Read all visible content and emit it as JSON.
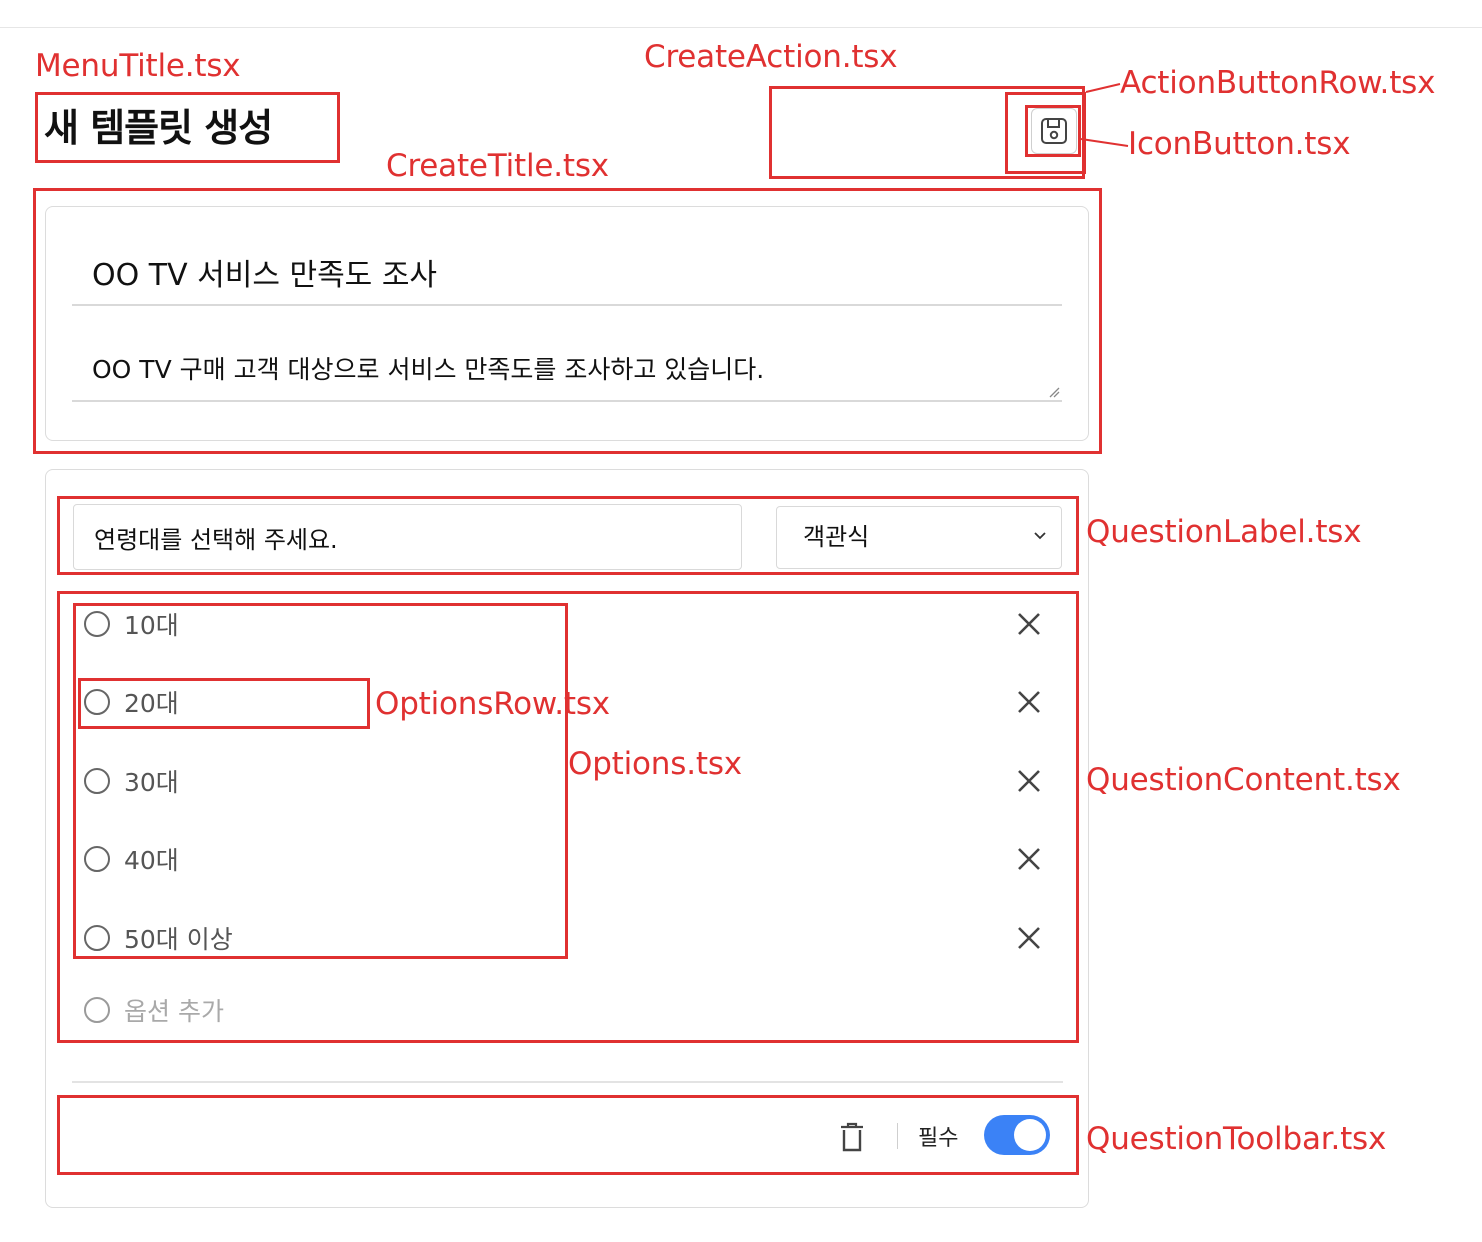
{
  "header": {
    "page_title": "새 템플릿 생성",
    "save_icon": "floppy-disk-save-icon"
  },
  "survey": {
    "title_value": "OO TV 서비스 만족도 조사",
    "description_value": "OO TV 구매 고객 대상으로 서비스 만족도를 조사하고 있습니다."
  },
  "question": {
    "label_value": "연령대를 선택해 주세요.",
    "type_selected": "객관식",
    "options": [
      "10대",
      "20대",
      "30대",
      "40대",
      "50대 이상"
    ],
    "add_option_placeholder": "옵션 추가",
    "required_label": "필수",
    "required_on": true
  },
  "annotations": {
    "menu_title": "MenuTitle.tsx",
    "create_action": "CreateAction.tsx",
    "action_button_row": "ActionButtonRow.tsx",
    "icon_button": "IconButton.tsx",
    "create_title": "CreateTitle.tsx",
    "question_label": "QuestionLabel.tsx",
    "options_row": "OptionsRow.tsx",
    "options": "Options.tsx",
    "question_content": "QuestionContent.tsx",
    "question_toolbar": "QuestionToolbar.tsx"
  },
  "colors": {
    "annotation": "#e03131",
    "toggle_on": "#3b82f6",
    "border": "#dcdcdc"
  }
}
